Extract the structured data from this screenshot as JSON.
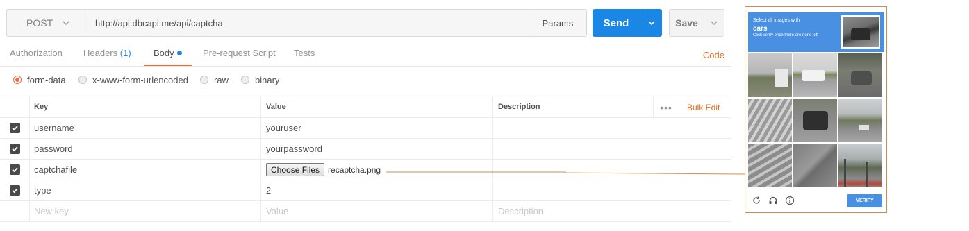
{
  "request": {
    "method": "POST",
    "url": "http://api.dbcapi.me/api/captcha",
    "params_label": "Params",
    "send_label": "Send",
    "save_label": "Save"
  },
  "tabs": {
    "authorization": "Authorization",
    "headers": "Headers",
    "headers_count": "(1)",
    "body": "Body",
    "prerequest": "Pre-request Script",
    "tests": "Tests",
    "code": "Code"
  },
  "body_types": {
    "form_data": "form-data",
    "urlencoded": "x-www-form-urlencoded",
    "raw": "raw",
    "binary": "binary",
    "selected": "form-data"
  },
  "table": {
    "headers": {
      "key": "Key",
      "value": "Value",
      "description": "Description"
    },
    "bulk_edit": "Bulk Edit",
    "rows": [
      {
        "checked": true,
        "key": "username",
        "value": "youruser",
        "description": ""
      },
      {
        "checked": true,
        "key": "password",
        "value": "yourpassword",
        "description": ""
      },
      {
        "checked": true,
        "key": "captchafile",
        "file_button": "Choose Files",
        "value": "recaptcha.png",
        "description": ""
      },
      {
        "checked": true,
        "key": "type",
        "value": "2",
        "description": ""
      }
    ],
    "new_row": {
      "key": "New key",
      "value": "Value",
      "description": "Description"
    }
  },
  "captcha": {
    "instruction_line1": "Select all images with",
    "target": "cars",
    "instruction_line2": "Click verify once there are none left",
    "verify_label": "VERIFY"
  },
  "colors": {
    "accent": "#f26b3a",
    "send_blue": "#1a87e7",
    "link_orange": "#e46d1e",
    "captcha_blue": "#4a90e2"
  }
}
